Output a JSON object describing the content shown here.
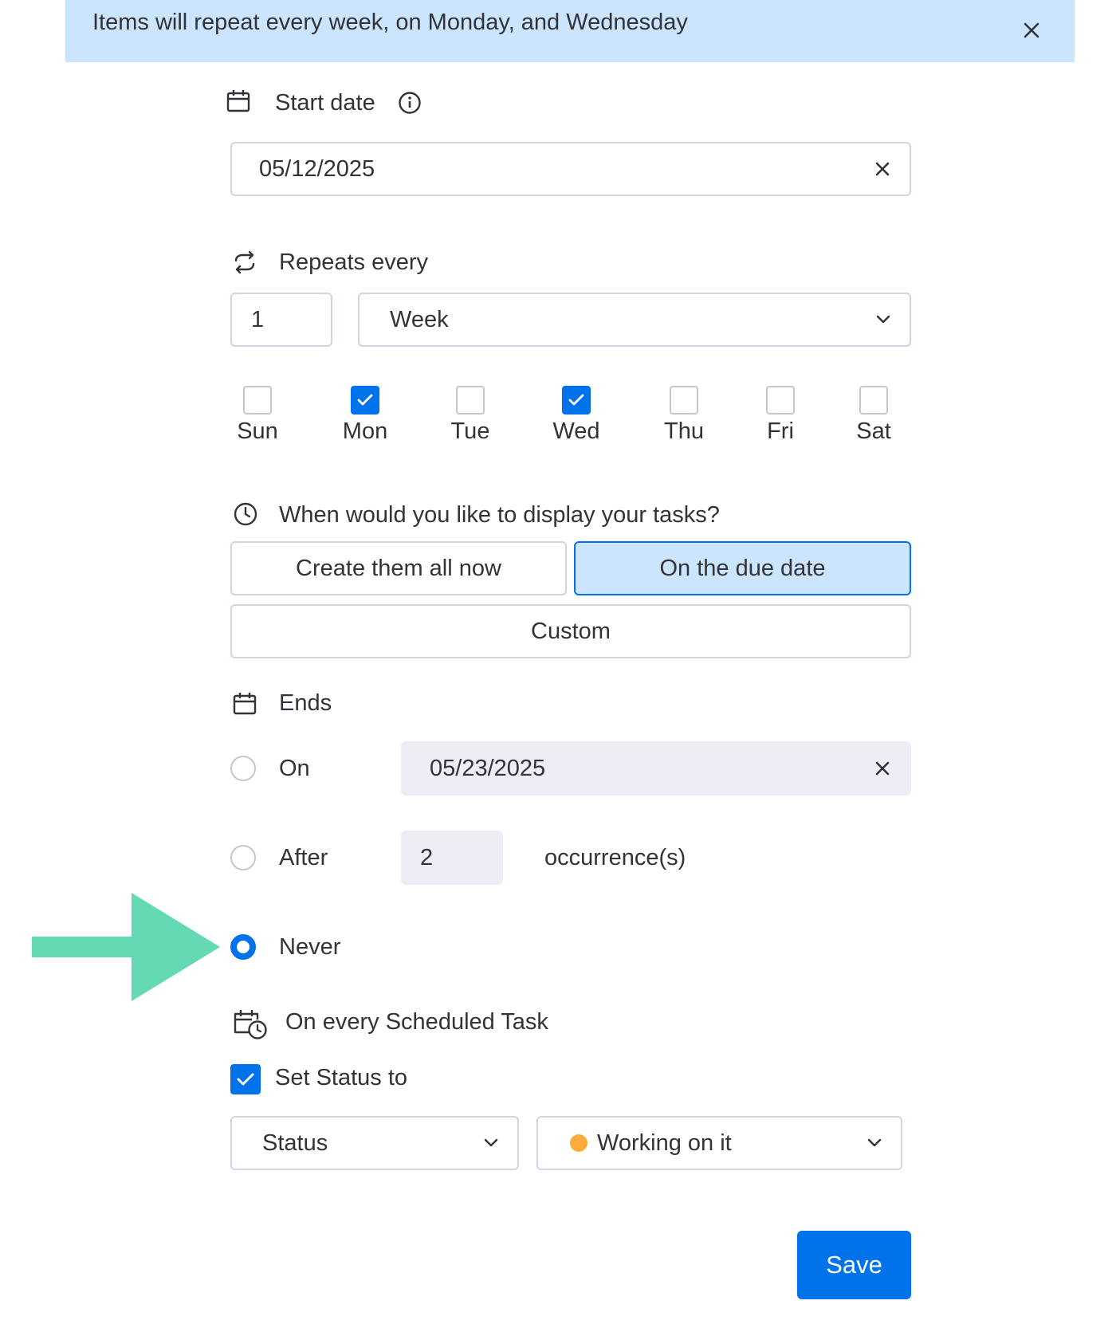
{
  "banner": {
    "text": "Items will repeat every week, on Monday, and Wednesday"
  },
  "start_date": {
    "label": "Start date",
    "value": "05/12/2025"
  },
  "repeats": {
    "label": "Repeats every",
    "interval": "1",
    "unit": "Week",
    "days": [
      {
        "label": "Sun",
        "checked": false
      },
      {
        "label": "Mon",
        "checked": true
      },
      {
        "label": "Tue",
        "checked": false
      },
      {
        "label": "Wed",
        "checked": true
      },
      {
        "label": "Thu",
        "checked": false
      },
      {
        "label": "Fri",
        "checked": false
      },
      {
        "label": "Sat",
        "checked": false
      }
    ]
  },
  "display": {
    "question": "When would you like to display your tasks?",
    "options": [
      "Create them all now",
      "On the due date",
      "Custom"
    ],
    "selected": "On the due date"
  },
  "ends": {
    "label": "Ends",
    "on_label": "On",
    "on_date": "05/23/2025",
    "after_label": "After",
    "after_count": "2",
    "occurrences_label": "occurrence(s)",
    "never_label": "Never",
    "selected": "Never"
  },
  "scheduled": {
    "label": "On every Scheduled Task",
    "set_status_label": "Set Status to",
    "set_status_checked": true,
    "column": "Status",
    "status_value": "Working on it",
    "status_color": "#fdab3d"
  },
  "save_label": "Save",
  "colors": {
    "accent": "#0073ea",
    "banner_bg": "#cce5ff",
    "arrow": "#65d9b4"
  }
}
